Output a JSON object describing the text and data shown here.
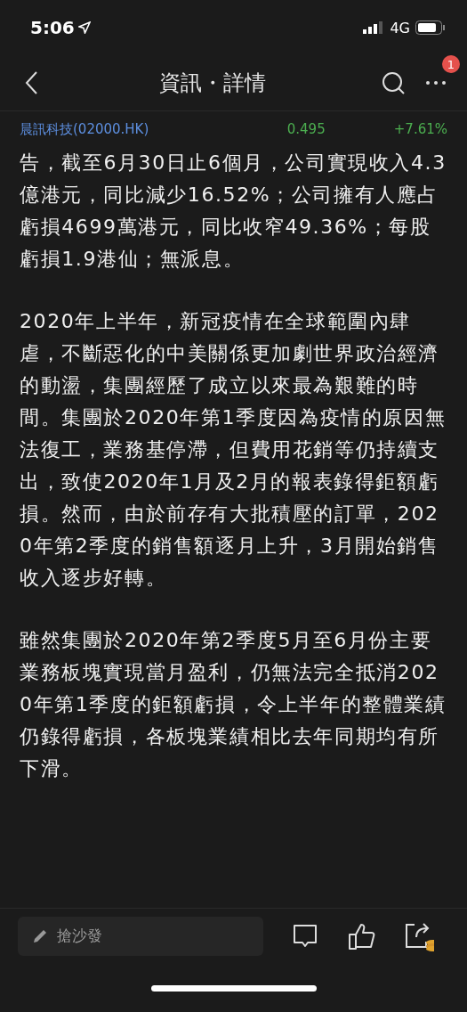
{
  "status_bar": {
    "time": "5:06",
    "network": "4G"
  },
  "nav": {
    "title": "資訊・詳情",
    "badge": "1"
  },
  "stock": {
    "name": "晨訊科技(02000.HK)",
    "price": "0.495",
    "change": "+7.61%"
  },
  "article": {
    "paragraphs": [
      "告，截至6月30日止6個月，公司實現收入4.3億港元，同比減少16.52%；公司擁有人應占虧損4699萬港元，同比收窄49.36%；每股虧損1.9港仙；無派息。",
      "2020年上半年，新冠疫情在全球範圍內肆虐，不斷惡化的中美關係更加劇世界政治經濟的動盪，集團經歷了成立以來最為艱難的時間。集團於2020年第1季度因為疫情的原因無法復工，業務基停滯，但費用花銷等仍持續支出，致使2020年1月及2月的報表錄得鉅額虧損。然而，由於前存有大批積壓的訂單，2020年第2季度的銷售額逐月上升，3月開始銷售收入逐步好轉。",
      "雖然集團於2020年第2季度5月至6月份主要業務板塊實現當月盈利，仍無法完全抵消2020年第1季度的鉅額虧損，令上半年的整體業績仍錄得虧損，各板塊業績相比去年同期均有所下滑。"
    ]
  },
  "comment_bar": {
    "placeholder": "搶沙發"
  }
}
